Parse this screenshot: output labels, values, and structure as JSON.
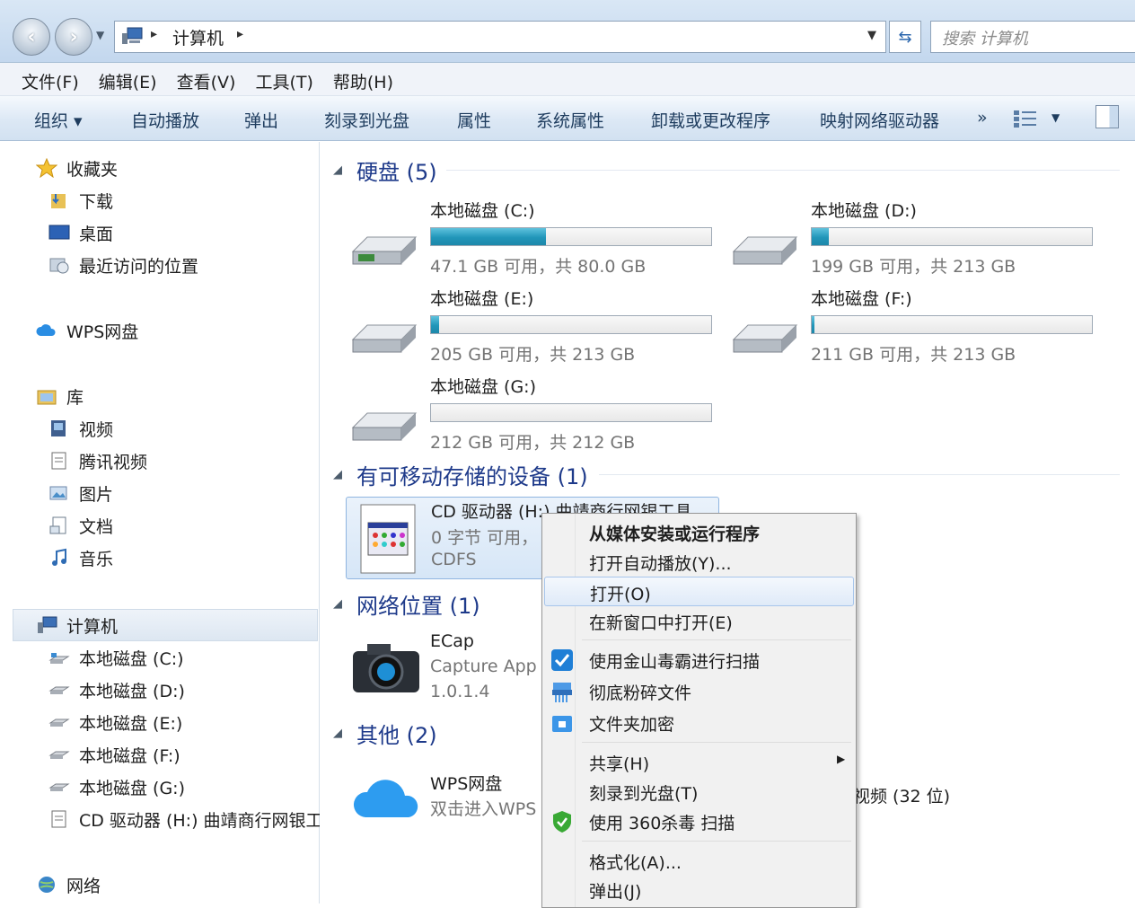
{
  "address_bar": {
    "path": "计算机",
    "search_placeholder": "搜索 计算机",
    "back": "‹",
    "forward": "›"
  },
  "menubar": [
    "文件(F)",
    "编辑(E)",
    "查看(V)",
    "工具(T)",
    "帮助(H)"
  ],
  "toolbar": {
    "organize": "组织 ▾",
    "autoplay": "自动播放",
    "eject": "弹出",
    "burn": "刻录到光盘",
    "properties": "属性",
    "system_properties": "系统属性",
    "uninstall": "卸载或更改程序",
    "map_drive": "映射网络驱动器",
    "more": "»"
  },
  "nav": {
    "favorites": {
      "label": "收藏夹",
      "items": [
        "下载",
        "桌面",
        "最近访问的位置"
      ]
    },
    "wps": "WPS网盘",
    "library": {
      "label": "库",
      "items": [
        "视频",
        "腾讯视频",
        "图片",
        "文档",
        "音乐"
      ]
    },
    "computer": {
      "label": "计算机",
      "items": [
        "本地磁盘 (C:)",
        "本地磁盘 (D:)",
        "本地磁盘 (E:)",
        "本地磁盘 (F:)",
        "本地磁盘 (G:)",
        "CD 驱动器 (H:) 曲靖商行网银工"
      ]
    },
    "network": "网络"
  },
  "groups": {
    "hdd": "硬盘 (5)",
    "removable": "有可移动存储的设备 (1)",
    "network": "网络位置 (1)",
    "other": "其他 (2)"
  },
  "drives": [
    {
      "name": "本地磁盘 (C:)",
      "free": "47.1 GB 可用，共 80.0 GB",
      "used_fraction": 0.41
    },
    {
      "name": "本地磁盘 (D:)",
      "free": "199 GB 可用，共 213 GB",
      "used_fraction": 0.06
    },
    {
      "name": "本地磁盘 (E:)",
      "free": "205 GB 可用，共 213 GB",
      "used_fraction": 0.03
    },
    {
      "name": "本地磁盘 (F:)",
      "free": "211 GB 可用，共 213 GB",
      "used_fraction": 0.01
    },
    {
      "name": "本地磁盘 (G:)",
      "free": "212 GB 可用，共 212 GB",
      "used_fraction": 0.0
    }
  ],
  "cd": {
    "name": "CD 驱动器 (H:) 曲靖商行网银工具",
    "free": "0 字节 可用，",
    "fs": "CDFS"
  },
  "ecap": {
    "name": "ECap",
    "sub": "Capture App",
    "version": "1.0.1.4"
  },
  "other": {
    "wps_name": "WPS网盘",
    "wps_sub": "双击进入WPS",
    "video_name": "视频 (32 位)"
  },
  "context_menu": [
    {
      "label": "从媒体安装或运行程序",
      "bold": true
    },
    {
      "label": "打开自动播放(Y)..."
    },
    {
      "label": "打开(O)",
      "highlighted": true
    },
    {
      "label": "在新窗口中打开(E)"
    },
    {
      "label": "使用金山毒霸进行扫描"
    },
    {
      "label": "彻底粉碎文件"
    },
    {
      "label": "文件夹加密"
    },
    {
      "label": "共享(H)"
    },
    {
      "label": "刻录到光盘(T)"
    },
    {
      "label": "使用 360杀毒 扫描"
    },
    {
      "label": "格式化(A)..."
    },
    {
      "label": "弹出(J)"
    }
  ],
  "colors": {
    "accent_blue": "#1e3a8a",
    "bar_fill": "#2196b9",
    "gray_text": "#747474"
  }
}
